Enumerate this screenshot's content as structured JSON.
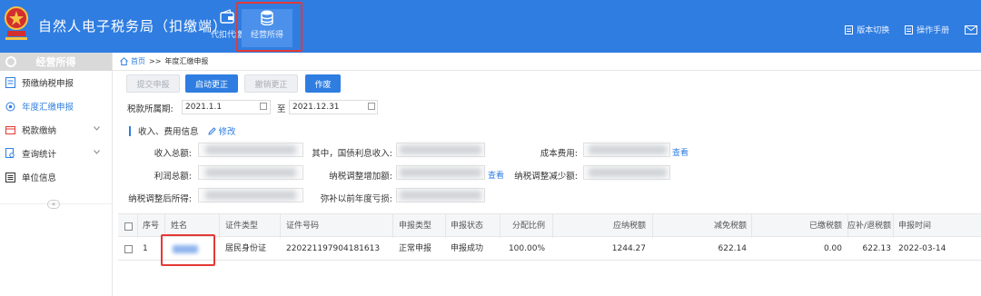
{
  "header": {
    "title": "自然人电子税务局（扣缴端）",
    "nav": [
      {
        "label": "代扣代缴",
        "icon": "wallet-icon",
        "active": false
      },
      {
        "label": "经营所得",
        "icon": "coins-icon",
        "active": true
      }
    ],
    "links": [
      {
        "label": "版本切换",
        "icon": "document-icon"
      },
      {
        "label": "操作手册",
        "icon": "document-icon"
      }
    ],
    "mail_icon": "mail-icon"
  },
  "sidebar": {
    "title": "经营所得",
    "items": [
      {
        "label": "预缴纳税申报",
        "icon": "form-icon"
      },
      {
        "label": "年度汇缴申报",
        "icon": "gear-icon",
        "active": true
      },
      {
        "label": "税款缴纳",
        "icon": "payment-icon",
        "expandable": true
      },
      {
        "label": "查询统计",
        "icon": "search-doc-icon",
        "expandable": true
      },
      {
        "label": "单位信息",
        "icon": "list-icon"
      }
    ],
    "collapse": "«"
  },
  "breadcrumb": {
    "home": "首页",
    "sep": ">>",
    "current": "年度汇缴申报"
  },
  "toolbar": {
    "submit": "提交申报",
    "start_correction": "启动更正",
    "cancel_correction": "撤销更正",
    "void": "作废"
  },
  "period": {
    "label": "税款所属期:",
    "start": "2021.1.1",
    "to": "至",
    "end": "2021.12.31"
  },
  "section": {
    "title": "收入、费用信息",
    "edit": "修改"
  },
  "fields": {
    "total_income": "收入总额:",
    "treasury_interest": "其中，国债利息收入:",
    "cost_expense": "成本费用:",
    "total_profit": "利润总额:",
    "tax_adj_increase": "纳税调整增加额:",
    "tax_adj_decrease": "纳税调整减少额:",
    "adjusted_income": "纳税调整后所得:",
    "loss_offset": "弥补以前年度亏损:",
    "view1": "查看",
    "view2": "查看"
  },
  "table": {
    "headers": [
      "序号",
      "姓名",
      "证件类型",
      "证件号码",
      "申报类型",
      "申报状态",
      "分配比例",
      "应纳税额",
      "减免税额",
      "已缴税额",
      "应补/退税额",
      "申报时间"
    ],
    "rows": [
      {
        "index": "1",
        "id_type": "居民身份证",
        "id_number": "220221197904181613",
        "decl_type": "正常申报",
        "status": "申报成功",
        "ratio": "100.00%",
        "tax_payable": "1244.27",
        "tax_relief": "622.14",
        "tax_paid": "0.00",
        "tax_due": "622.13",
        "date": "2022-03-14"
      }
    ]
  },
  "colors": {
    "primary": "#2f7de1",
    "highlight": "#e53935"
  }
}
